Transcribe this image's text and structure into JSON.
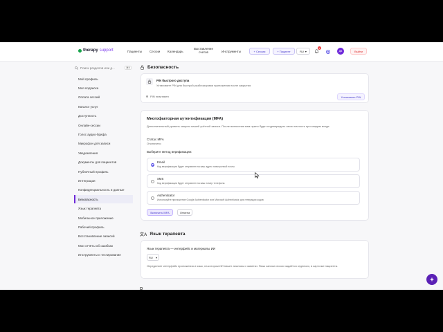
{
  "header": {
    "logo_main": "therapy",
    "logo_suffix": "support",
    "nav": [
      "Пациенты",
      "Сессии",
      "Календарь",
      "Выставление счетов",
      "Инструменты"
    ],
    "session_button": "+ Сессия",
    "patient_button": "+ Пациент",
    "language": "RU",
    "notification_count": "3",
    "avatar_initials": "ДВ",
    "logout": "Выйти"
  },
  "sidebar": {
    "search_placeholder": "Поиск разделов или д...",
    "search_shortcut": "⌘K",
    "items": [
      "Мой профиль",
      "Моя подписка",
      "Оплата сессий",
      "Каталог услуг",
      "Доступность",
      "Онлайн-сессии",
      "Голос аудио-брифа",
      "Микрофон для записи",
      "Уведомления",
      "Документы для пациентов",
      "Публичный профиль",
      "Интеграции",
      "Конфиденциальность и данные",
      "Безопасность",
      "Язык терапевта",
      "Мобильное приложение",
      "Рабочий профиль",
      "Восстановление записей",
      "Мои отчёты об ошибках",
      "Инструменты и тестирование"
    ],
    "active_index": 13
  },
  "security": {
    "title": "Безопасность",
    "pin": {
      "title": "PIN быстрого доступа",
      "desc": "Установите PIN для быстрой разблокировки приложения после закрытия",
      "status": "PIN неактивен",
      "button": "Установить PIN"
    },
    "mfa": {
      "title": "Многофакторная аутентификация (MFA)",
      "desc": "Дополнительный уровень защиты вашей учётной записи. После включения вам нужно будет подтверждать свою личность при каждом входе.",
      "status_label": "Статус MFA",
      "status_value": "Отключено",
      "method_label": "Выберите метод верификации:",
      "options": [
        {
          "title": "Email",
          "desc": "Код верификации будет отправлен на ваш адрес электронной почты"
        },
        {
          "title": "SMS",
          "desc": "Код верификации будет отправлен на ваш номер телефона"
        },
        {
          "title": "Authenticator",
          "desc": "Используйте приложение Google Authenticator или Microsoft Authenticator для генерации кодов"
        }
      ],
      "selected_index": 0,
      "enable_button": "Включить MFA",
      "cancel_button": "Отмена"
    }
  },
  "therapist_language": {
    "title": "Язык терапевта",
    "label": "Язык терапевта — интерфейс и материалы ИИ",
    "value": "RU",
    "desc": "Определяет интерфейс приложения и язык, на котором ИИ пишет анализы и заметки. Язык записи сессии задаётся отдельно, в карточке пациента."
  },
  "colors": {
    "accent": "#6d28d9",
    "danger": "#dc2626",
    "success": "#16a34a"
  }
}
